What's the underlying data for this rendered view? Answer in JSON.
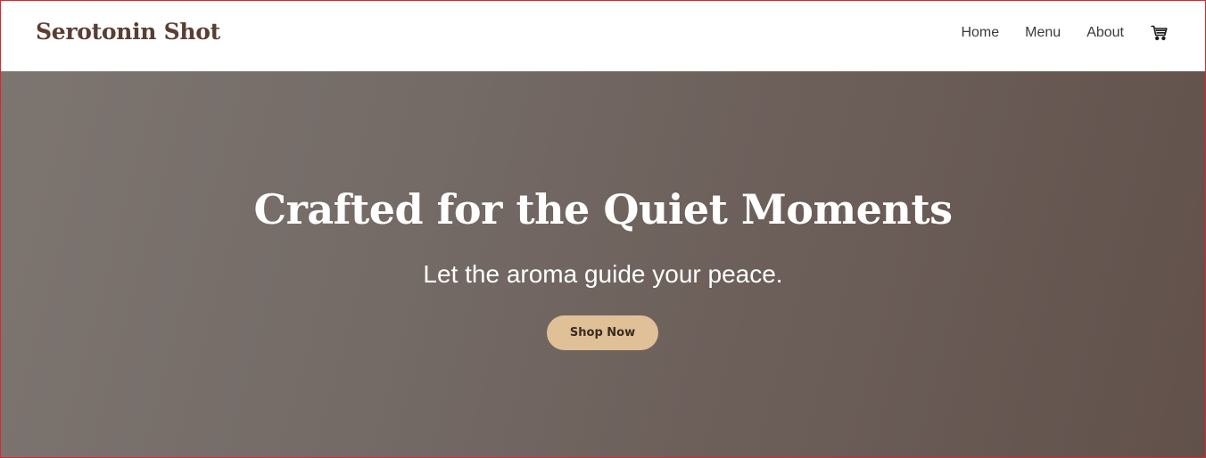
{
  "header": {
    "brand": "Serotonin Shot",
    "nav": [
      {
        "label": "Home"
      },
      {
        "label": "Menu"
      },
      {
        "label": "About"
      }
    ],
    "cart_icon": "shopping-cart-icon"
  },
  "hero": {
    "title": "Crafted for the Quiet Moments",
    "subtitle": "Let the aroma guide your peace.",
    "cta_label": "Shop Now"
  },
  "colors": {
    "brand_text": "#5a3d33",
    "hero_gradient_start": "#7d7570",
    "hero_gradient_end": "#62514b",
    "cta_background": "#e0c097",
    "frame_border": "#d9272e"
  }
}
